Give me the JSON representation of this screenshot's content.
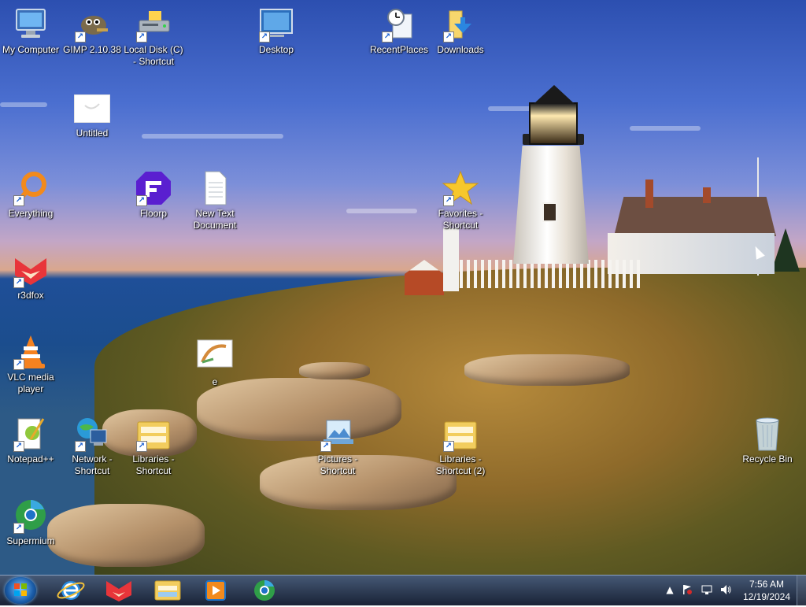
{
  "desktop": {
    "icons": [
      {
        "label": "My Computer",
        "icon": "computer-icon"
      },
      {
        "label": "GIMP 2.10.38",
        "icon": "gimp-icon"
      },
      {
        "label": "Local Disk (C) - Shortcut",
        "icon": "drive-icon"
      },
      {
        "label": "Desktop",
        "icon": "desktop-folder-icon"
      },
      {
        "label": "RecentPlaces",
        "icon": "recent-places-icon"
      },
      {
        "label": "Downloads",
        "icon": "downloads-folder-icon"
      },
      {
        "label": "Untitled",
        "icon": "image-file-icon"
      },
      {
        "label": "Everything",
        "icon": "everything-search-icon"
      },
      {
        "label": "Floorp",
        "icon": "floorp-browser-icon"
      },
      {
        "label": "New Text Document",
        "icon": "text-document-icon"
      },
      {
        "label": "Favorites - Shortcut",
        "icon": "favorites-star-icon"
      },
      {
        "label": "r3dfox",
        "icon": "r3dfox-browser-icon"
      },
      {
        "label": "e",
        "icon": "picture-file-icon"
      },
      {
        "label": "VLC media player",
        "icon": "vlc-cone-icon"
      },
      {
        "label": "Notepad++",
        "icon": "notepadpp-icon"
      },
      {
        "label": "Network - Shortcut",
        "icon": "network-globe-icon"
      },
      {
        "label": "Libraries - Shortcut",
        "icon": "libraries-folder-icon"
      },
      {
        "label": "Pictures - Shortcut",
        "icon": "pictures-folder-icon"
      },
      {
        "label": "Libraries - Shortcut (2)",
        "icon": "libraries-folder-icon"
      },
      {
        "label": "Recycle Bin",
        "icon": "recycle-bin-icon"
      },
      {
        "label": "Supermium",
        "icon": "supermium-browser-icon"
      }
    ]
  },
  "taskbar": {
    "start_button": "start-orb-icon",
    "pinned_apps": [
      {
        "name": "Internet Explorer",
        "icon": "internet-explorer-icon"
      },
      {
        "name": "r3dfox",
        "icon": "r3dfox-browser-icon"
      },
      {
        "name": "Windows Explorer",
        "icon": "file-explorer-icon"
      },
      {
        "name": "Windows Media Player",
        "icon": "media-player-icon"
      },
      {
        "name": "Supermium",
        "icon": "supermium-browser-icon"
      }
    ],
    "tray": {
      "show_hidden": "▲",
      "clock_time": "7:56 AM",
      "clock_date": "12/19/2024"
    }
  },
  "colors": {
    "taskbar_top": "#3c506e",
    "taskbar_bottom": "#141e32",
    "label_text": "#ffffff"
  }
}
